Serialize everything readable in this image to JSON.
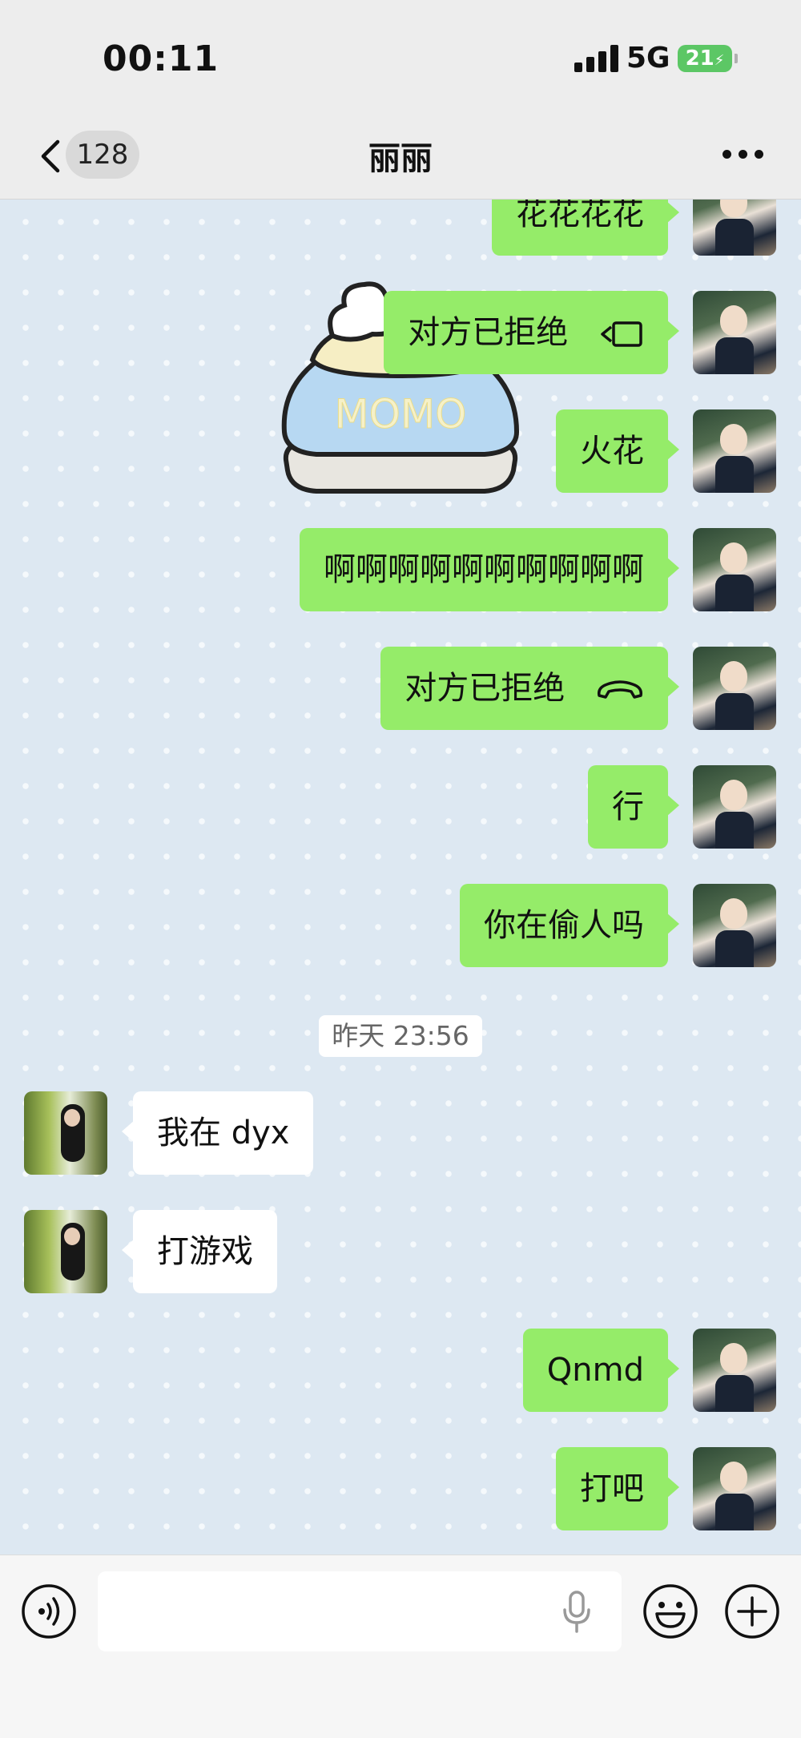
{
  "status_bar": {
    "time": "00:11",
    "network": "5G",
    "battery": "21"
  },
  "nav": {
    "unread_count": "128",
    "title": "丽丽"
  },
  "colors": {
    "my_bubble": "#95ec69",
    "their_bubble": "#ffffff",
    "chat_background": "#dde8f2"
  },
  "sticker": {
    "text": "MOMO"
  },
  "messages": [
    {
      "from": "me",
      "text": "花花花花"
    },
    {
      "from": "me",
      "text": "对方已拒绝",
      "icon": "video-call-icon"
    },
    {
      "from": "me",
      "text": "火花"
    },
    {
      "from": "me",
      "text": "啊啊啊啊啊啊啊啊啊啊"
    },
    {
      "from": "me",
      "text": "对方已拒绝",
      "icon": "phone-hangup-icon"
    },
    {
      "from": "me",
      "text": "行"
    },
    {
      "from": "me",
      "text": "你在偷人吗"
    },
    {
      "from": "them",
      "text": "我在 dyx"
    },
    {
      "from": "them",
      "text": "打游戏"
    },
    {
      "from": "me",
      "text": "Qnmd"
    },
    {
      "from": "me",
      "text": "打吧"
    }
  ],
  "timestamp": "昨天 23:56",
  "input": {
    "value": "",
    "placeholder": ""
  },
  "icons": {
    "voice": "voice-icon",
    "mic": "mic-icon",
    "emoji": "emoji-icon",
    "more": "plus-icon"
  }
}
